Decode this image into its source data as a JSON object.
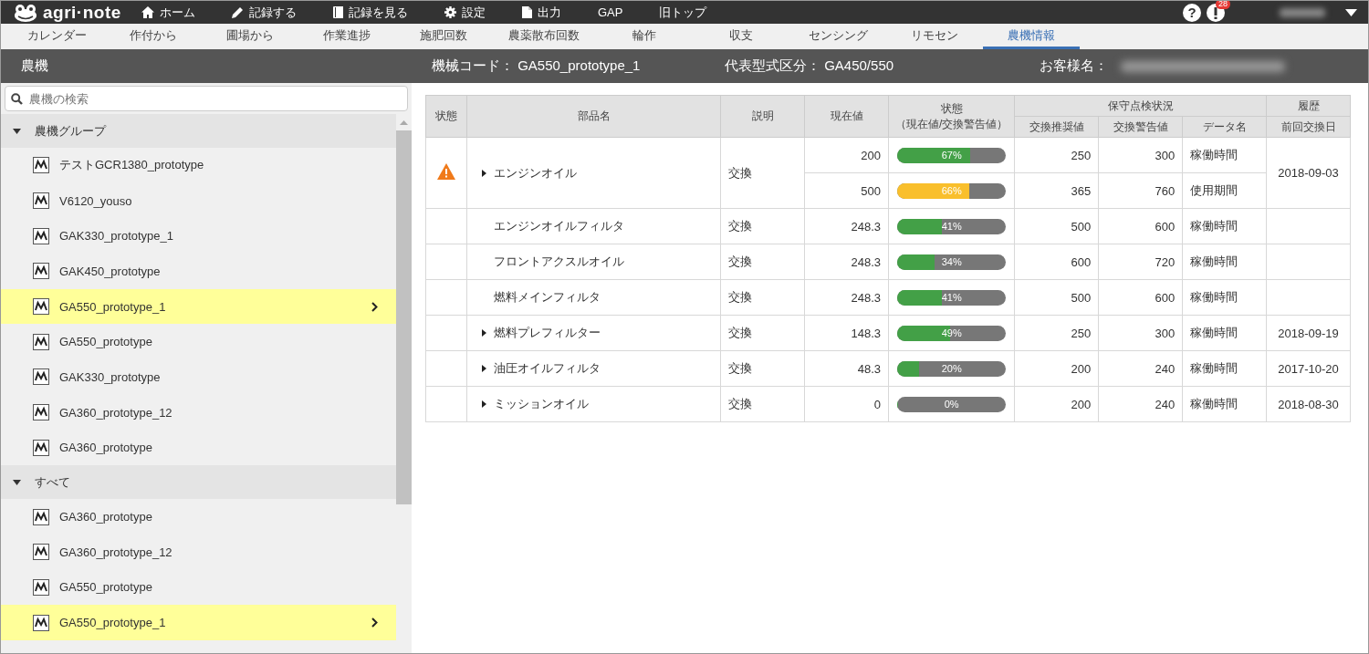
{
  "app": {
    "logo": "agri·note",
    "nav": [
      {
        "label": "ホーム"
      },
      {
        "label": "記録する"
      },
      {
        "label": "記録を見る"
      },
      {
        "label": "設定"
      },
      {
        "label": "出力"
      },
      {
        "label": "GAP"
      },
      {
        "label": "旧トップ"
      }
    ],
    "help_glyph": "?",
    "notification_count": "28"
  },
  "tabs": [
    {
      "label": "カレンダー",
      "selected": false
    },
    {
      "label": "作付から",
      "selected": false
    },
    {
      "label": "圃場から",
      "selected": false
    },
    {
      "label": "作業進捗",
      "selected": false
    },
    {
      "label": "施肥回数",
      "selected": false
    },
    {
      "label": "農薬散布回数",
      "selected": false
    },
    {
      "label": "輪作",
      "selected": false
    },
    {
      "label": "収支",
      "selected": false
    },
    {
      "label": "センシング",
      "selected": false
    },
    {
      "label": "リモセン",
      "selected": false
    },
    {
      "label": "農機情報",
      "selected": true
    }
  ],
  "header": {
    "title": "農機",
    "machine_code": "機械コード： GA550_prototype_1",
    "model_class": "代表型式区分： GA450/550",
    "customer_label": "お客様名："
  },
  "sidebar": {
    "search": {
      "placeholder": "農機の検索"
    },
    "groups": [
      {
        "label": "農機グループ",
        "expanded": true,
        "children": [
          {
            "name": "テストGCR1380_prototype",
            "selected": false
          },
          {
            "name": "V6120_youso",
            "selected": false
          },
          {
            "name": "GAK330_prototype_1",
            "selected": false
          },
          {
            "name": "GAK450_prototype",
            "selected": false
          },
          {
            "name": "GA550_prototype_1",
            "selected": true
          },
          {
            "name": "GA550_prototype",
            "selected": false
          },
          {
            "name": "GAK330_prototype",
            "selected": false
          },
          {
            "name": "GA360_prototype_12",
            "selected": false
          },
          {
            "name": "GA360_prototype",
            "selected": false
          }
        ]
      },
      {
        "label": "すべて",
        "expanded": true,
        "children": [
          {
            "name": "GA360_prototype",
            "selected": false
          },
          {
            "name": "GA360_prototype_12",
            "selected": false
          },
          {
            "name": "GA550_prototype",
            "selected": false
          },
          {
            "name": "GA550_prototype_1",
            "selected": true
          }
        ]
      }
    ]
  },
  "table": {
    "columns": {
      "status": "状態",
      "part": "部品名",
      "description": "説明",
      "current": "現在値",
      "gauge": "状態",
      "gauge_sub": "（現在値/交換警告値）",
      "maintenance": "保守点検状況",
      "recommended": "交換推奨値",
      "warning": "交換警告値",
      "data_name": "データ名",
      "history": "履歴",
      "last_replaced": "前回交換日"
    },
    "rows": [
      {
        "alert": true,
        "expandable": true,
        "part": "エンジンオイル",
        "description": "交換",
        "last_replaced": "2018-09-03",
        "readings": [
          {
            "current": "200",
            "level": 0.67,
            "label": "67%",
            "color": "#43a047",
            "recommended": "250",
            "warning": "300",
            "data_name": "稼働時間"
          },
          {
            "current": "500",
            "level": 0.66,
            "label": "66%",
            "color": "#f9bf2c",
            "recommended": "365",
            "warning": "760",
            "data_name": "使用期間"
          }
        ]
      },
      {
        "alert": false,
        "expandable": false,
        "part": "エンジンオイルフィルタ",
        "description": "交換",
        "readings": [
          {
            "current": "248.3",
            "level": 0.41,
            "label": "41%",
            "color": "#43a047",
            "recommended": "500",
            "warning": "600",
            "data_name": "稼働時間"
          }
        ]
      },
      {
        "alert": false,
        "expandable": false,
        "part": "フロントアクスルオイル",
        "description": "交換",
        "readings": [
          {
            "current": "248.3",
            "level": 0.34,
            "label": "34%",
            "color": "#43a047",
            "recommended": "600",
            "warning": "720",
            "data_name": "稼働時間"
          }
        ]
      },
      {
        "alert": false,
        "expandable": false,
        "part": "燃料メインフィルタ",
        "description": "交換",
        "readings": [
          {
            "current": "248.3",
            "level": 0.41,
            "label": "41%",
            "color": "#43a047",
            "recommended": "500",
            "warning": "600",
            "data_name": "稼働時間"
          }
        ]
      },
      {
        "alert": false,
        "expandable": true,
        "part": "燃料プレフィルター",
        "description": "交換",
        "last_replaced": "2018-09-19",
        "readings": [
          {
            "current": "148.3",
            "level": 0.49,
            "label": "49%",
            "color": "#43a047",
            "recommended": "250",
            "warning": "300",
            "data_name": "稼働時間"
          }
        ]
      },
      {
        "alert": false,
        "expandable": true,
        "part": "油圧オイルフィルタ",
        "description": "交換",
        "last_replaced": "2017-10-20",
        "readings": [
          {
            "current": "48.3",
            "level": 0.2,
            "label": "20%",
            "color": "#43a047",
            "recommended": "200",
            "warning": "240",
            "data_name": "稼働時間"
          }
        ]
      },
      {
        "alert": false,
        "expandable": true,
        "part": "ミッションオイル",
        "description": "交換",
        "last_replaced": "2018-08-30",
        "readings": [
          {
            "current": "0",
            "level": 0,
            "label": "0%",
            "recommended": "200",
            "warning": "240",
            "data_name": "稼働時間"
          }
        ]
      }
    ]
  }
}
